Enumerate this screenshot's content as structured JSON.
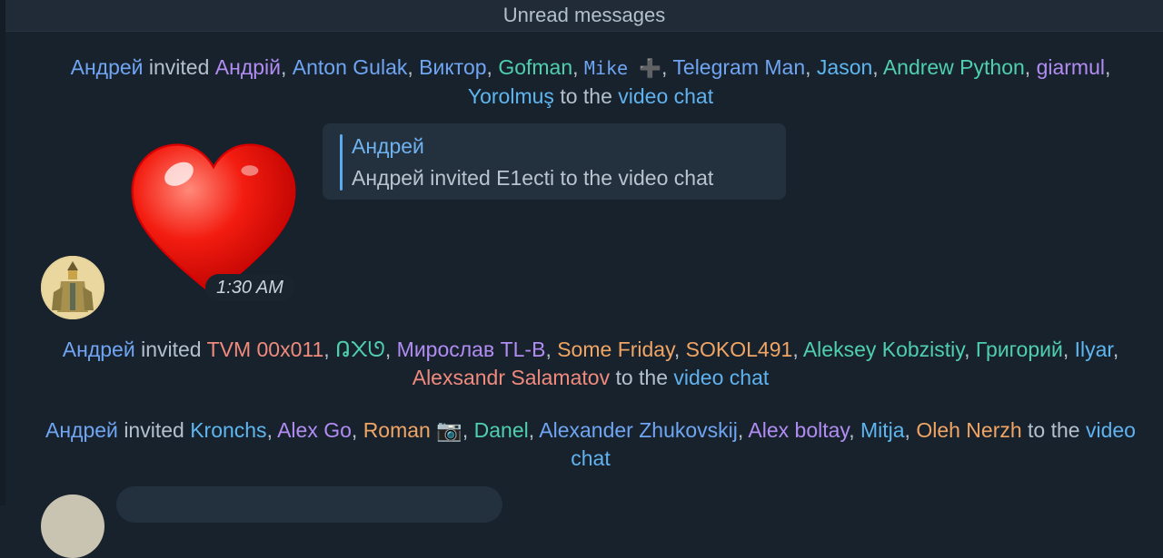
{
  "banner": {
    "label": "Unread messages"
  },
  "service1": {
    "actor": "Андрей",
    "verb": "invited",
    "guests": [
      {
        "name": "Андрій",
        "color": "#b18cf2"
      },
      {
        "name": "Anton Gulak",
        "color": "#6fa5f2"
      },
      {
        "name": "Виктор",
        "color": "#6fa5f2"
      },
      {
        "name": "Gofman",
        "color": "#4fcfae"
      },
      {
        "name": "Mike ➕",
        "color": "#6fa5f2"
      },
      {
        "name": "Telegram Man",
        "color": "#6fa5f2"
      },
      {
        "name": "Jason",
        "color": "#5eb6f0"
      },
      {
        "name": "Andrew Python",
        "color": "#4fcfae"
      },
      {
        "name": "giarmul",
        "color": "#b18cf2"
      },
      {
        "name": "Yorolmuş",
        "color": "#5eb6f0"
      }
    ],
    "to_the": "to the",
    "target": "video chat"
  },
  "reply": {
    "author": "Андрей",
    "text": "Андрей invited E1ecti to the video chat"
  },
  "sticker": {
    "icon": "heart-icon",
    "time": "1:30 AM"
  },
  "service2": {
    "actor": "Андрей",
    "verb": "invited",
    "guests": [
      {
        "name": "TVM 00x011",
        "color": "#f08a7c"
      },
      {
        "name": "ᕡ᙭ᘎ",
        "color": "#4fcfae"
      },
      {
        "name": "Мирослав TL-B",
        "color": "#b18cf2"
      },
      {
        "name": "Some Friday",
        "color": "#f0a564"
      },
      {
        "name": "SOKOL491",
        "color": "#f0a564"
      },
      {
        "name": "Aleksey Kobzistiy",
        "color": "#4fcfae"
      },
      {
        "name": "Григорий",
        "color": "#4fcfae"
      },
      {
        "name": "Ilyar",
        "color": "#5eb6f0"
      },
      {
        "name": "Alexsandr Salamatov",
        "color": "#f08a7c"
      }
    ],
    "to_the": "to the",
    "target": "video chat"
  },
  "service3": {
    "actor": "Андрей",
    "verb": "invited",
    "guests": [
      {
        "name": "Kronchs",
        "color": "#5eb6f0"
      },
      {
        "name": "Alex Go",
        "color": "#b18cf2"
      },
      {
        "name": "Roman 📷",
        "color": "#f0a564"
      },
      {
        "name": "Danel",
        "color": "#4fcfae"
      },
      {
        "name": "Alexander Zhukovskij",
        "color": "#6fa5f2"
      },
      {
        "name": "Alex boltay",
        "color": "#b18cf2"
      },
      {
        "name": "Mitja",
        "color": "#5eb6f0"
      },
      {
        "name": "Oleh Nerzh",
        "color": "#f0a564"
      }
    ],
    "to_the": "to the",
    "target": "video chat"
  }
}
